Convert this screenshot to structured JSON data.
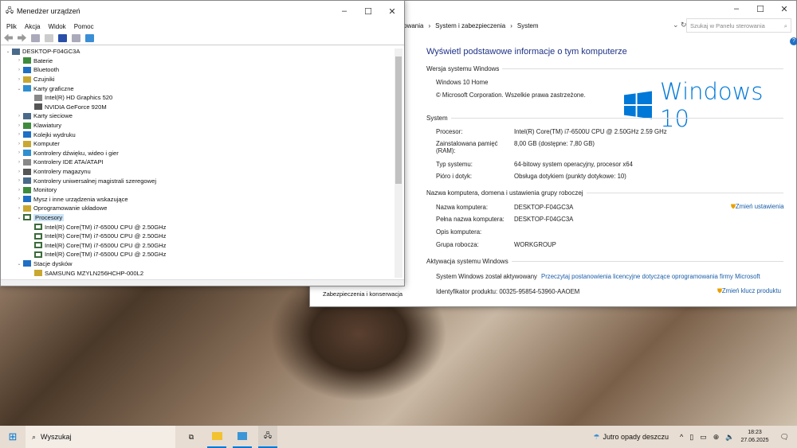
{
  "device_manager": {
    "title": "Menedżer urządzeń",
    "menu": [
      "Plik",
      "Akcja",
      "Widok",
      "Pomoc"
    ],
    "tree": [
      {
        "label": "DESKTOP-F04GC3A",
        "level": 0,
        "expanded": true
      },
      {
        "label": "Baterie",
        "level": 1
      },
      {
        "label": "Bluetooth",
        "level": 1
      },
      {
        "label": "Czujniki",
        "level": 1
      },
      {
        "label": "Karty graficzne",
        "level": 1,
        "expanded": true
      },
      {
        "label": "Intel(R) HD Graphics 520",
        "level": 2
      },
      {
        "label": "NVIDIA GeForce 920M",
        "level": 2
      },
      {
        "label": "Karty sieciowe",
        "level": 1
      },
      {
        "label": "Klawiatury",
        "level": 1
      },
      {
        "label": "Kolejki wydruku",
        "level": 1
      },
      {
        "label": "Komputer",
        "level": 1
      },
      {
        "label": "Kontrolery dźwięku, wideo i gier",
        "level": 1
      },
      {
        "label": "Kontrolery IDE ATA/ATAPI",
        "level": 1
      },
      {
        "label": "Kontrolery magazynu",
        "level": 1
      },
      {
        "label": "Kontrolery uniwersalnej magistrali szeregowej",
        "level": 1
      },
      {
        "label": "Monitory",
        "level": 1
      },
      {
        "label": "Mysz i inne urządzenia wskazujące",
        "level": 1
      },
      {
        "label": "Oprogramowanie układowe",
        "level": 1
      },
      {
        "label": "Procesory",
        "level": 1,
        "expanded": true,
        "selected": true
      },
      {
        "label": "Intel(R) Core(TM) i7-6500U CPU @ 2.50GHz",
        "level": 2
      },
      {
        "label": "Intel(R) Core(TM) i7-6500U CPU @ 2.50GHz",
        "level": 2
      },
      {
        "label": "Intel(R) Core(TM) i7-6500U CPU @ 2.50GHz",
        "level": 2
      },
      {
        "label": "Intel(R) Core(TM) i7-6500U CPU @ 2.50GHz",
        "level": 2
      },
      {
        "label": "Stacje dysków",
        "level": 1,
        "expanded": true
      },
      {
        "label": "SAMSUNG MZYLN256HCHP-000L2",
        "level": 2
      }
    ]
  },
  "system": {
    "breadcrumb": [
      "erowania",
      "System i zabezpieczenia",
      "System"
    ],
    "search_placeholder": "Szukaj w Panelu sterowania",
    "heading": "Wyświetl podstawowe informacje o tym komputerze",
    "edition_section": "Wersja systemu Windows",
    "edition": "Windows 10 Home",
    "copyright": "© Microsoft Corporation. Wszelkie prawa zastrzeżone.",
    "logo_text": "Windows 10",
    "system_section": "System",
    "system_rows": [
      {
        "k": "Procesor:",
        "v": "Intel(R) Core(TM) i7-6500U CPU @ 2.50GHz   2.59 GHz"
      },
      {
        "k": "Zainstalowana pamięć (RAM):",
        "v": "8,00 GB (dostępne: 7,80 GB)"
      },
      {
        "k": "Typ systemu:",
        "v": "64-bitowy system operacyjny, procesor x64"
      },
      {
        "k": "Pióro i dotyk:",
        "v": "Obsługa dotykiem (punkty dotykowe: 10)"
      }
    ],
    "name_section": "Nazwa komputera, domena i ustawienia grupy roboczej",
    "name_rows": [
      {
        "k": "Nazwa komputera:",
        "v": "DESKTOP-F04GC3A"
      },
      {
        "k": "Pełna nazwa komputera:",
        "v": "DESKTOP-F04GC3A"
      },
      {
        "k": "Opis komputera:",
        "v": ""
      },
      {
        "k": "Grupa robocza:",
        "v": "WORKGROUP"
      }
    ],
    "change_settings": "Zmień ustawienia",
    "activation_section": "Aktywacja systemu Windows",
    "activated": "System Windows został aktywowany",
    "license_link": "Przeczytaj postanowienia licencyjne dotyczące oprogramowania firmy Microsoft",
    "product_id": "Identyfikator produktu: 00325-95854-53960-AAOEM",
    "change_key": "Zmień klucz produktu",
    "sidebar_partial": "Zabezpieczenia i konserwacja"
  },
  "taskbar": {
    "search": "Wyszukaj",
    "weather": "Jutro opady deszczu",
    "time": "18:23",
    "date": "27.06.2025"
  }
}
